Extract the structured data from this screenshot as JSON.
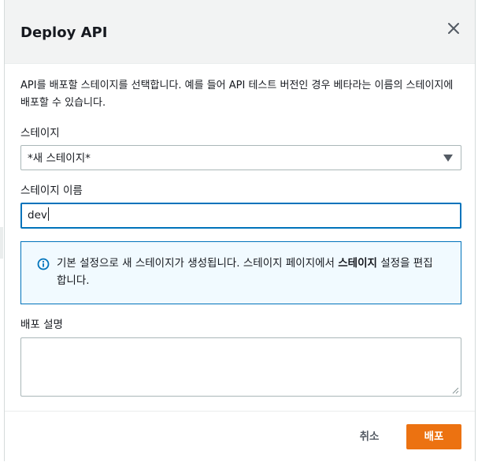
{
  "modal": {
    "title": "Deploy API",
    "description": "API를 배포할 스테이지를 선택합니다. 예를 들어 API 테스트 버전인 경우 베타라는 이름의 스테이지에 배포할 수 있습니다."
  },
  "stage": {
    "label": "스테이지",
    "selected": "*새 스테이지*"
  },
  "stage_name": {
    "label": "스테이지 이름",
    "value": "dev"
  },
  "info": {
    "text_before": "기본 설정으로 새 스테이지가 생성됩니다. 스테이지 페이지에서 ",
    "text_bold": "스테이지",
    "text_after": " 설정을 편집합니다."
  },
  "deploy_description": {
    "label": "배포 설명",
    "value": ""
  },
  "footer": {
    "cancel_label": "취소",
    "deploy_label": "배포"
  },
  "colors": {
    "accent": "#ec7211",
    "focus": "#0073bb",
    "info_bg": "#f1faff"
  },
  "icons": {
    "close": "close-icon",
    "dropdown": "caret-down-icon",
    "info": "info-icon"
  }
}
